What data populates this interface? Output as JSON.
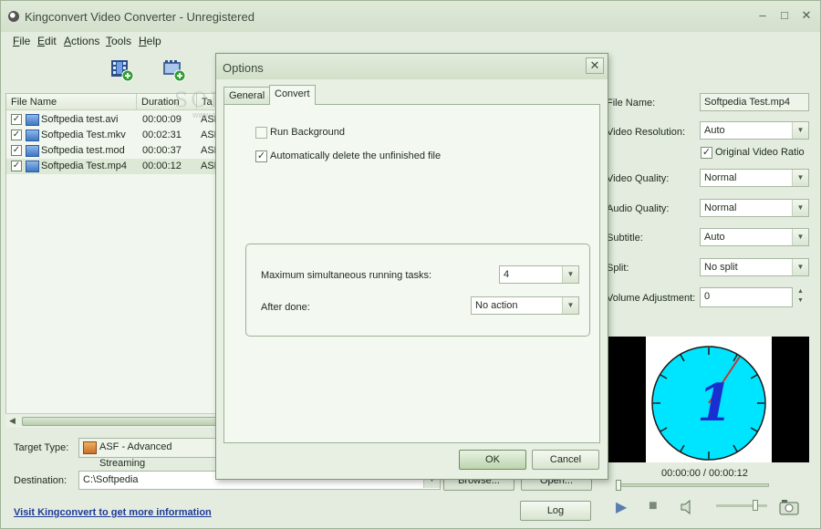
{
  "window": {
    "title": "Kingconvert Video Converter - Unregistered"
  },
  "menu": {
    "file": {
      "key": "F",
      "rest": "ile"
    },
    "edit": {
      "key": "E",
      "rest": "dit"
    },
    "actions": {
      "key": "A",
      "rest": "ctions"
    },
    "tools": {
      "key": "T",
      "rest": "ools"
    },
    "help": {
      "key": "H",
      "rest": "elp"
    }
  },
  "file_list": {
    "columns": [
      "File Name",
      "Duration",
      "Ta"
    ],
    "rows": [
      {
        "name": "Softpedia test.avi",
        "duration": "00:00:09",
        "format": "ASF",
        "checked": true
      },
      {
        "name": "Softpedia Test.mkv",
        "duration": "00:02:31",
        "format": "ASF",
        "checked": true
      },
      {
        "name": "Softpedia test.mod",
        "duration": "00:00:37",
        "format": "ASF",
        "checked": true
      },
      {
        "name": "Softpedia Test.mp4",
        "duration": "00:00:12",
        "format": "ASF",
        "checked": true
      }
    ]
  },
  "watermark": {
    "text": "SOFTPEDIA",
    "url": "www.softpedia.com"
  },
  "bottom": {
    "target_type_label": "Target Type:",
    "target_type_value": "ASF - Advanced Streaming",
    "destination_label": "Destination:",
    "destination_value": "C:\\Softpedia",
    "browse_label": "Browse...",
    "open_label": "Open...",
    "log_label": "Log",
    "visit_link": "Visit Kingconvert to get more information"
  },
  "properties": {
    "file_name_label": "File Name:",
    "file_name_value": "Softpedia Test.mp4",
    "video_resolution_label": "Video Resolution:",
    "video_resolution_value": "Auto",
    "original_ratio_label": "Original Video Ratio",
    "video_quality_label": "Video Quality:",
    "video_quality_value": "Normal",
    "audio_quality_label": "Audio Quality:",
    "audio_quality_value": "Normal",
    "subtitle_label": "Subtitle:",
    "subtitle_value": "Auto",
    "split_label": "Split:",
    "split_value": "No split",
    "volume_label": "Volume Adjustment:",
    "volume_value": "0"
  },
  "player": {
    "time": "00:00:00 / 00:00:12",
    "seek_fraction": 0.0,
    "volume_fraction": 0.8,
    "clock_digit": "1"
  },
  "dialog": {
    "title": "Options",
    "close_glyph": "✕",
    "tabs": [
      "General",
      "Convert"
    ],
    "active_tab": "Convert",
    "run_background_label": "Run Background",
    "run_background_checked": false,
    "auto_delete_label": "Automatically delete the unfinished file",
    "auto_delete_checked": true,
    "max_tasks_label": "Maximum simultaneous running tasks:",
    "max_tasks_value": "4",
    "after_done_label": "After done:",
    "after_done_value": "No action",
    "ok_label": "OK",
    "cancel_label": "Cancel"
  },
  "colors": {
    "accent": "#1e3a9a",
    "clock_face": "#00e5ff",
    "clock_digit": "#1a2fd0",
    "clock_hand": "#c0392b"
  }
}
